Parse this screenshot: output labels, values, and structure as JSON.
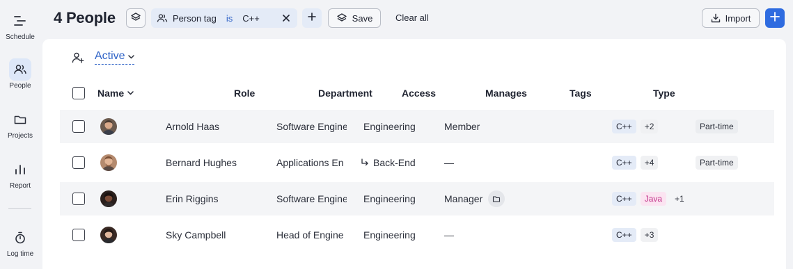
{
  "sidebar": {
    "items": [
      {
        "label": "Schedule",
        "icon": "schedule-icon"
      },
      {
        "label": "People",
        "icon": "people-icon",
        "active": true
      },
      {
        "label": "Projects",
        "icon": "folder-icon"
      },
      {
        "label": "Report",
        "icon": "bar-chart-icon"
      },
      {
        "label": "Log time",
        "icon": "stopwatch-icon"
      }
    ]
  },
  "header": {
    "title": "4 People",
    "filter": {
      "field": "Person tag",
      "operator": "is",
      "value": "C++"
    },
    "save_label": "Save",
    "clear_all_label": "Clear all",
    "import_label": "Import"
  },
  "status_filter": {
    "label": "Active"
  },
  "table": {
    "columns": [
      "Name",
      "Role",
      "Department",
      "Access",
      "Manages",
      "Tags",
      "Type"
    ],
    "rows": [
      {
        "name": "Arnold Haas",
        "role": "Software Engine",
        "department": "Engineering",
        "access": "Member",
        "tags": [
          "C++"
        ],
        "tags_more": "+2",
        "type": "Part-time"
      },
      {
        "name": "Bernard Hughes",
        "role": "Applications En",
        "department": "Back-End",
        "department_sub": true,
        "access": "—",
        "tags": [
          "C++"
        ],
        "tags_more": "+4",
        "type": "Part-time"
      },
      {
        "name": "Erin Riggins",
        "role": "Software Engine",
        "department": "Engineering",
        "access": "Manager",
        "tags": [
          "C++",
          "Java"
        ],
        "tags_more": "+1",
        "type": ""
      },
      {
        "name": "Sky Campbell",
        "role": "Head of Engine",
        "department": "Engineering",
        "access": "—",
        "tags": [
          "C++"
        ],
        "tags_more": "+3",
        "type": ""
      }
    ]
  },
  "colors": {
    "accent": "#2e6be0",
    "link": "#2f63c7",
    "java_tag": "#c2338a"
  }
}
